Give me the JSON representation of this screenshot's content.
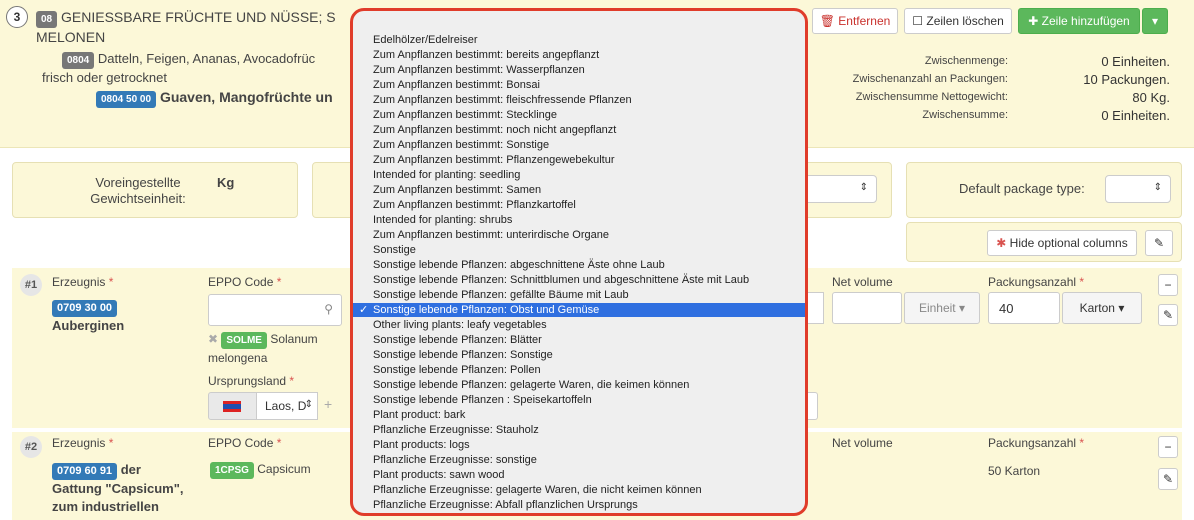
{
  "section": {
    "number": "3",
    "category_code": "08",
    "category_title": "GENIESSBARE FRÜCHTE UND NÜSSE; S",
    "category_title_line2": "MELONEN",
    "sub_code": "0804",
    "sub_title": "Datteln, Feigen, Ananas, Avocadofrüc",
    "sub_title_line2": "frisch oder getrocknet",
    "sub2_code": "0804 50 00",
    "sub2_title": "Guaven, Mangofrüchte un"
  },
  "toolbar": {
    "remove_label": "Entfernen",
    "delete_rows_label": "Zeilen löschen",
    "add_row_label": "Zeile hinzufügen"
  },
  "summary": {
    "rows": [
      {
        "label": "Zwischenmenge:",
        "value": "0 Einheiten."
      },
      {
        "label": "Zwischenanzahl an Packungen:",
        "value": "10 Packungen."
      },
      {
        "label": "Zwischensumme Nettogewicht:",
        "value": "80 Kg."
      },
      {
        "label": "Zwischensumme:",
        "value": "0 Einheiten."
      }
    ]
  },
  "settings": {
    "weight_unit_label": "Voreingestellte Gewichtseinheit:",
    "weight_unit_value": "Kg",
    "package_type_label": "Default package type:",
    "hide_optional_label": "Hide optional columns"
  },
  "rows": [
    {
      "num": "#1",
      "product_label": "Erzeugnis",
      "product_code": "0709 30 00",
      "product_name": "Auberginen",
      "eppo_label": "EPPO Code",
      "eppo_code": "SOLME",
      "eppo_name": "Solanum",
      "eppo_name_line2": "melongena",
      "origin_label": "Ursprungsland",
      "origin_value": "Laos, D",
      "net_volume_label": "Net volume",
      "unit_label": "Einheit",
      "packages_label": "Packungsanzahl",
      "packages_value": "40",
      "package_type": "Karton"
    },
    {
      "num": "#2",
      "product_label": "Erzeugnis",
      "product_code": "0709 60 91",
      "product_name_suffix": "der",
      "product_name_line2": "Gattung \"Capsicum\",",
      "product_name_line3": "zum industriellen",
      "eppo_label": "EPPO Code",
      "eppo_code": "1CPSG",
      "eppo_name": "Capsicum",
      "net_volume_label": "Net volume",
      "packages_label": "Packungsanzahl",
      "packages_value": "50 Karton"
    }
  ],
  "dropdown": {
    "selected_index": 19,
    "options": [
      "Edelhölzer/Edelreiser",
      "Zum Anpflanzen bestimmt: bereits angepflanzt",
      "Zum Anpflanzen bestimmt: Wasserpflanzen",
      "Zum Anpflanzen bestimmt: Bonsai",
      "Zum Anpflanzen bestimmt: fleischfressende Pflanzen",
      "Zum Anpflanzen bestimmt: Stecklinge",
      "Zum Anpflanzen bestimmt: noch nicht angepflanzt",
      "Zum Anpflanzen bestimmt: Sonstige",
      "Zum Anpflanzen bestimmt: Pflanzengewebekultur",
      "Intended for planting: seedling",
      "Zum Anpflanzen bestimmt: Samen",
      "Zum Anpflanzen bestimmt: Pflanzkartoffel",
      "Intended for planting: shrubs",
      "Zum Anpflanzen bestimmt: unterirdische Organe",
      "Sonstige",
      "Sonstige lebende Pflanzen: abgeschnittene Äste ohne Laub",
      "Sonstige lebende Pflanzen: Schnittblumen und abgeschnittene Äste mit Laub",
      "Sonstige lebende Pflanzen: gefällte Bäume mit Laub",
      "Sonstige lebende Pflanzen: Obst und Gemüse",
      "Other living plants: leafy vegetables",
      "Sonstige lebende Pflanzen: Blätter",
      "Sonstige lebende Pflanzen: Sonstige",
      "Sonstige lebende Pflanzen: Pollen",
      "Sonstige lebende Pflanzen: gelagerte Waren, die keimen können",
      "Sonstige lebende Pflanzen : Speisekartoffeln",
      "Plant product: bark",
      "Pflanzliche Erzeugnisse: Stauholz",
      "Plant products: logs",
      "Pflanzliche Erzeugnisse: sonstige",
      "Plant products: sawn wood",
      "Pflanzliche Erzeugnisse: gelagerte Waren, die nicht keimen können",
      "Pflanzliche Erzeugnisse: Abfall pflanzlichen Ursprungs"
    ]
  },
  "colors": {
    "accent": "#337ab7",
    "success": "#5cb85c",
    "danger": "#d9534f",
    "highlight": "#2f6fe0",
    "outline": "#e03c2a"
  }
}
